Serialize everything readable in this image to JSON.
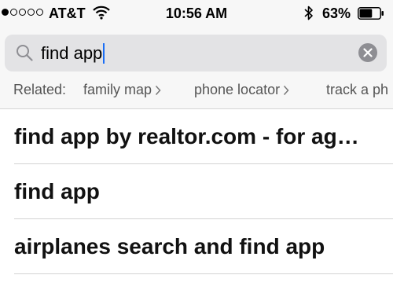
{
  "status_bar": {
    "carrier": "AT&T",
    "time": "10:56 AM",
    "battery_percent": "63%",
    "battery_level": 0.63,
    "signal_bars_filled": 1,
    "signal_bars_total": 5
  },
  "search": {
    "query": "find app"
  },
  "related": {
    "label": "Related:",
    "items": [
      {
        "label": "family map"
      },
      {
        "label": "phone locator"
      },
      {
        "label": "track a ph"
      }
    ]
  },
  "results": [
    {
      "text": "find app by realtor.com - for ag…"
    },
    {
      "text": "find app"
    },
    {
      "text": "airplanes search and find app"
    }
  ],
  "colors": {
    "caret": "#1b6ef5",
    "search_box_bg": "#e3e3e5",
    "clear_button_bg": "#8e8e93"
  }
}
